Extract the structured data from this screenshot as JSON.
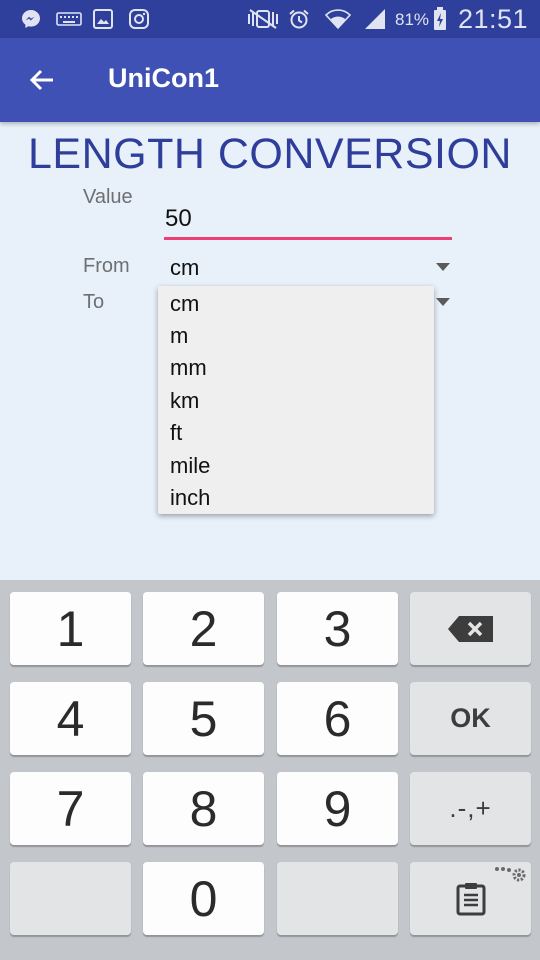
{
  "status_bar": {
    "battery_percent": "81%",
    "time": "21:51",
    "icons": [
      "messenger-icon",
      "keyboard-icon",
      "gallery-icon",
      "instagram-icon",
      "mute-vibrate-icon",
      "alarm-icon",
      "wifi-icon",
      "signal-icon",
      "battery-charging-icon"
    ]
  },
  "toolbar": {
    "back_icon": "arrow-back-icon",
    "title": "UniCon1"
  },
  "main": {
    "heading": "LENGTH CONVERSION",
    "value_label": "Value",
    "value_input": "50",
    "from_label": "From",
    "from_selected": "cm",
    "to_label": "To"
  },
  "dropdown": {
    "options": [
      "cm",
      "m",
      "mm",
      "km",
      "ft",
      "mile",
      "inch"
    ]
  },
  "keyboard": {
    "digits": [
      "1",
      "2",
      "3",
      "4",
      "5",
      "6",
      "7",
      "8",
      "9",
      "0"
    ],
    "ok_label": "OK",
    "symbols_label": ".-,+",
    "backspace_icon": "backspace-icon",
    "clipboard_icon": "clipboard-icon",
    "settings_icon": "keyboard-settings-icon"
  },
  "colors": {
    "status_bar": "#2f3f9c",
    "toolbar": "#3f51b5",
    "heading": "#2e3e9a",
    "input_underline": "#ee3f74",
    "background": "#e8f1fa"
  }
}
